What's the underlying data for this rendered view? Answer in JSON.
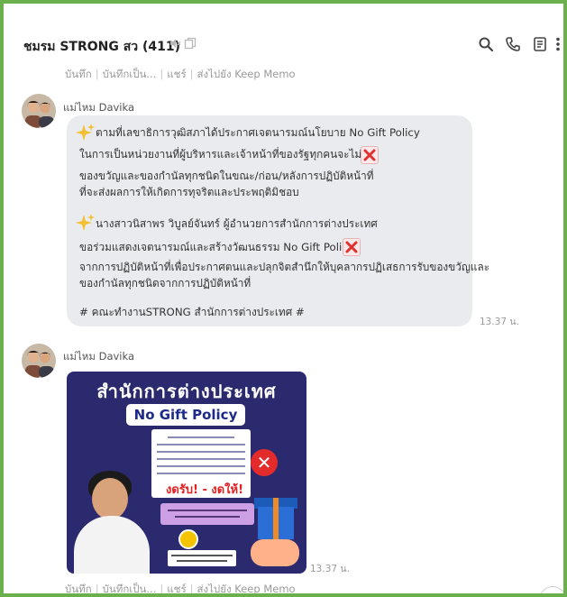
{
  "header": {
    "title": "ชมรม STRONG สว (411)",
    "icons": [
      "volume-mute-icon",
      "copy-icon",
      "search-icon",
      "phone-icon",
      "notes-icon",
      "more-icon"
    ]
  },
  "memo_bar": {
    "items": [
      "บันทึก",
      "บันทึกเป็น...",
      "แชร์",
      "ส่งไปยัง Keep Memo"
    ],
    "separator": "|"
  },
  "messages": [
    {
      "sender": "แม่ไหม Davika",
      "time": "13.37 น.",
      "lines": [
        "ตามที่เลขาธิการวุฒิสภาได้ประกาศเจตนารมณ์นโยบาย No Gift Policy",
        "ในการเป็นหน่วยงานที่ผู้บริหารและเจ้าหน้าที่ของรัฐทุกคนจะไม่รับ",
        "ของขวัญและของกำนัลทุกชนิดในขณะ/ก่อน/หลังการปฏิบัติหน้าที่",
        "ที่จะส่งผลการให้เกิดการทุจริตและประพฤติมิชอบ",
        "นางสาวนิสาพร  วิบูลย์จันทร์ ผู้อำนวยการสำนักการต่างประเทศ",
        "ขอร่วมแสดงเจตนารมณ์และสร้างวัฒนธรรม No Gift Policy",
        "จากการปฏิบัติหน้าที่เพื่อประกาศตนและปลุกจิตสำนึกให้บุคลากรปฏิเสธการรับของขวัญและ",
        "ของกำนัลทุกชนิดจากการปฏิบัติหน้าที่",
        "# คณะทำงานSTRONG  สำนักการต่างประเทศ #"
      ]
    },
    {
      "sender": "แม่ไหม Davika",
      "time": "13.37 น.",
      "poster": {
        "title": "สำนักการต่างประเทศ",
        "pill": "No Gift Policy",
        "slogan": "งดรับ! - งดให้!"
      }
    }
  ],
  "colors": {
    "frame_border": "#6ab04c",
    "bubble_bg": "#e9ebee",
    "poster_bg": "#2b2a6e",
    "x_mark": "#e03131"
  }
}
